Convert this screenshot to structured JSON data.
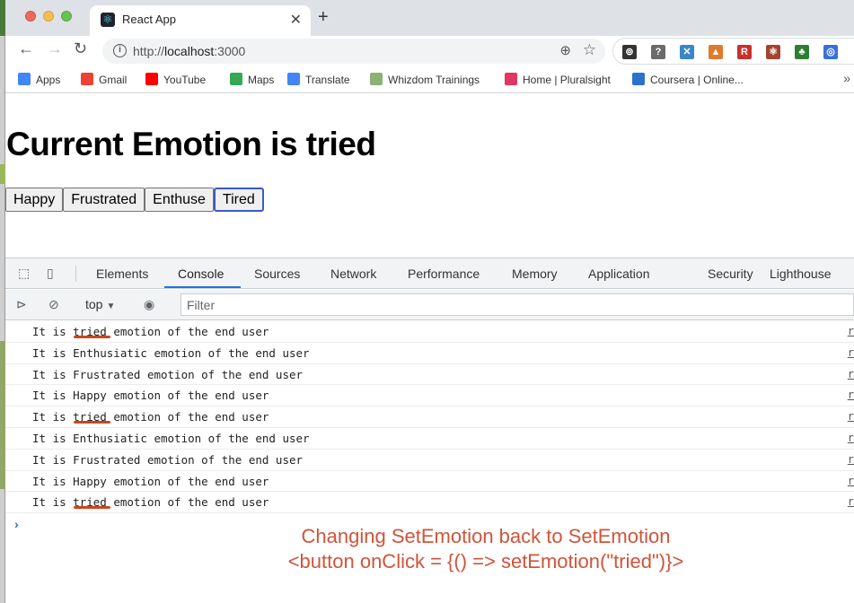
{
  "browser": {
    "tab": {
      "title": "React App",
      "favicon": "react-atom-icon"
    },
    "url": {
      "scheme": "http://",
      "host": "localhost",
      "port": ":3000"
    },
    "extensions": [
      {
        "icon": "extension-1-icon",
        "glyph": "⊚",
        "color": "#333333"
      },
      {
        "icon": "help-extension-icon",
        "glyph": "?",
        "color": "#6b6b6b"
      },
      {
        "icon": "x-extension-icon",
        "glyph": "✕",
        "color": "#3a86c8"
      },
      {
        "icon": "lighthouse-extension-icon",
        "glyph": "▲",
        "color": "#e07a2e"
      },
      {
        "icon": "r-extension-icon",
        "glyph": "R",
        "color": "#c9302c"
      },
      {
        "icon": "react-devtools-extension-icon",
        "glyph": "⚛",
        "color": "#a4442e"
      },
      {
        "icon": "tree-extension-icon",
        "glyph": "♣",
        "color": "#2e7d32"
      },
      {
        "icon": "compass-extension-icon",
        "glyph": "◎",
        "color": "#3a6fd8"
      }
    ],
    "bookmarks": [
      {
        "label": "Apps",
        "color": "#4285f4"
      },
      {
        "label": "Gmail",
        "color": "#ea4335"
      },
      {
        "label": "YouTube",
        "color": "#ff0000"
      },
      {
        "label": "Maps",
        "color": "#34a853"
      },
      {
        "label": "Translate",
        "color": "#4285f4"
      },
      {
        "label": "Whizdom Trainings",
        "color": "#8bb174"
      },
      {
        "label": "Home | Pluralsight",
        "color": "#e0365f"
      },
      {
        "label": "Coursera | Online...",
        "color": "#2a73cc"
      }
    ],
    "bookmarks_more": "»"
  },
  "page": {
    "heading": "Current Emotion is tried",
    "buttons": [
      "Happy",
      "Frustrated",
      "Enthuse",
      "Tired"
    ],
    "focused_button": "Tired"
  },
  "devtools": {
    "tabs": [
      "Elements",
      "Console",
      "Sources",
      "Network",
      "Performance",
      "Memory",
      "Application",
      "Security",
      "Lighthouse"
    ],
    "active_tab": "Console",
    "context": "top",
    "filter_placeholder": "Filter",
    "logs": [
      {
        "prefix": "It is ",
        "emotion": "tried",
        "suffix": " emotion of the end user",
        "highlight": true,
        "source": "r"
      },
      {
        "prefix": "It is ",
        "emotion": "Enthusiatic",
        "suffix": " emotion of the end user",
        "highlight": false,
        "source": "r"
      },
      {
        "prefix": "It is ",
        "emotion": "Frustrated",
        "suffix": " emotion of the end user",
        "highlight": false,
        "source": "r"
      },
      {
        "prefix": "It is ",
        "emotion": "Happy",
        "suffix": " emotion of the end user",
        "highlight": false,
        "source": "r"
      },
      {
        "prefix": "It is ",
        "emotion": "tried",
        "suffix": " emotion of the end user",
        "highlight": true,
        "source": "r"
      },
      {
        "prefix": "It is ",
        "emotion": "Enthusiatic",
        "suffix": " emotion of the end user",
        "highlight": false,
        "source": "r"
      },
      {
        "prefix": "It is ",
        "emotion": "Frustrated",
        "suffix": " emotion of the end user",
        "highlight": false,
        "source": "r"
      },
      {
        "prefix": "It is ",
        "emotion": "Happy",
        "suffix": " emotion of the end user",
        "highlight": false,
        "source": "r"
      },
      {
        "prefix": "It is ",
        "emotion": "tried",
        "suffix": " emotion of the end user",
        "highlight": true,
        "source": "r"
      }
    ],
    "prompt": "›"
  },
  "annotation": {
    "line1": "Changing SetEmotion back to SetEmotion",
    "line2": "<button onClick = {() => setEmotion(\"tried\")}>",
    "color": "#d0543a"
  }
}
